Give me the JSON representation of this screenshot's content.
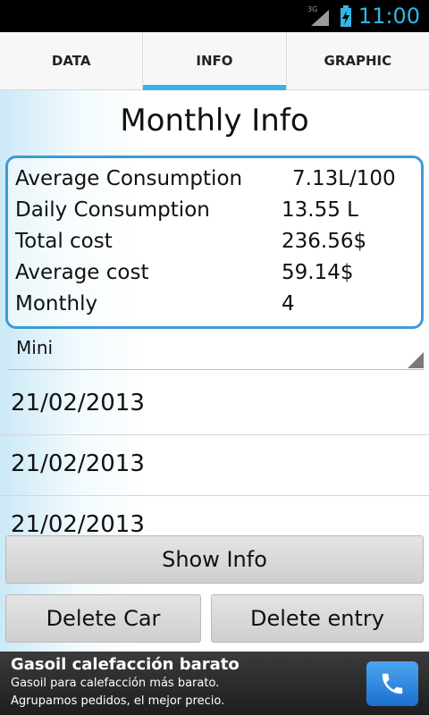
{
  "status_bar": {
    "time": "11:00",
    "network": "3G"
  },
  "tabs": [
    {
      "label": "DATA",
      "active": false
    },
    {
      "label": "INFO",
      "active": true
    },
    {
      "label": "GRAPHIC",
      "active": false
    }
  ],
  "page": {
    "title": "Monthly Info"
  },
  "info": {
    "rows": [
      {
        "label": "Average Consumption",
        "value": "7.13L/100"
      },
      {
        "label": "Daily Consumption",
        "value": "13.55 L"
      },
      {
        "label": "Total cost",
        "value": "236.56$"
      },
      {
        "label": "Average cost",
        "value": "59.14$"
      },
      {
        "label": "Monthly",
        "value": "4"
      }
    ]
  },
  "car_selector": {
    "selected": "Mini"
  },
  "entries": [
    "21/02/2013",
    "21/02/2013",
    "21/02/2013"
  ],
  "buttons": {
    "show_info": "Show Info",
    "delete_car": "Delete Car",
    "delete_entry": "Delete entry"
  },
  "ad": {
    "headline": "Gasoil calefacción barato",
    "line1": "Gasoil para calefacción más barato.",
    "line2": "Agrupamos pedidos, el mejor precio.",
    "icon": "phone-icon"
  },
  "colors": {
    "accent": "#33b5e5",
    "box_border": "#3d9bd6"
  }
}
